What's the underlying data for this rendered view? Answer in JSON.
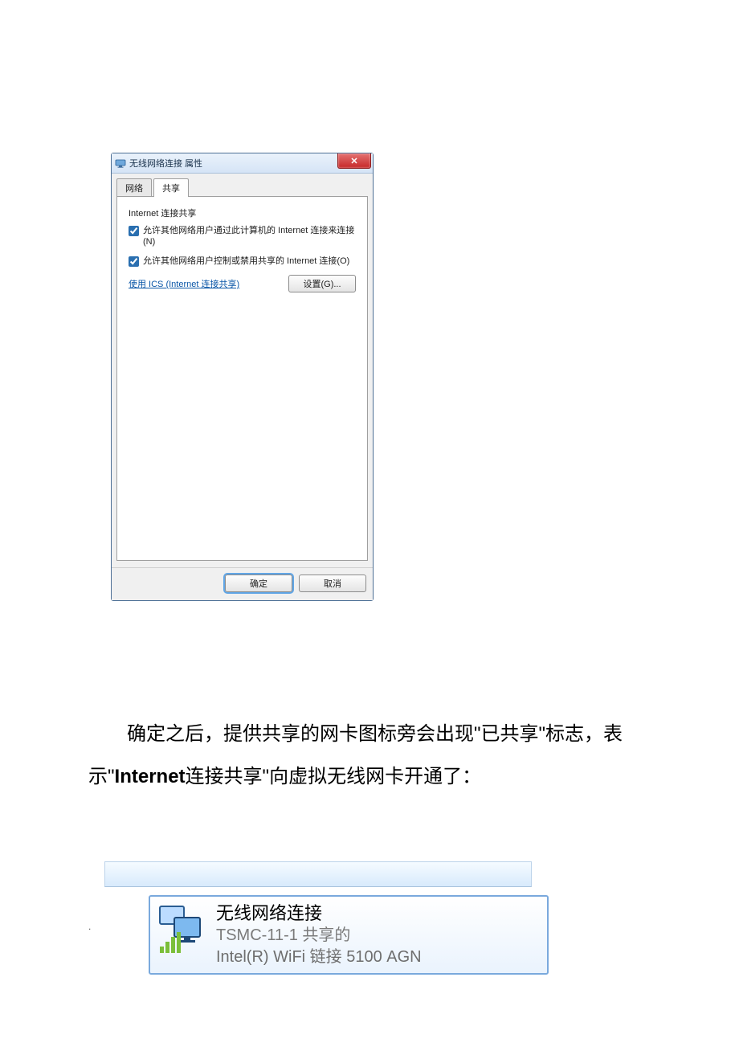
{
  "dialog": {
    "title": "无线网络连接 属性",
    "tabs": {
      "network": "网络",
      "sharing": "共享"
    },
    "group_title": "Internet 连接共享",
    "checkbox1": "允许其他网络用户通过此计算机的 Internet 连接来连接(N)",
    "checkbox2": "允许其他网络用户控制或禁用共享的 Internet 连接(O)",
    "ics_link": "使用 ICS (Internet 连接共享)",
    "settings_btn": "设置(G)...",
    "ok": "确定",
    "cancel": "取消"
  },
  "paragraph": {
    "p1": "确定之后，提供共享的网卡图标旁会出现\"已共享\"标志，表示\"",
    "bold": "Internet",
    "p2": "连接共享\"向虚拟无线网卡开通了："
  },
  "connection": {
    "name": "无线网络连接",
    "line2": "TSMC-11-1  共享的",
    "line3": "Intel(R) WiFi 链接 5100 AGN"
  }
}
